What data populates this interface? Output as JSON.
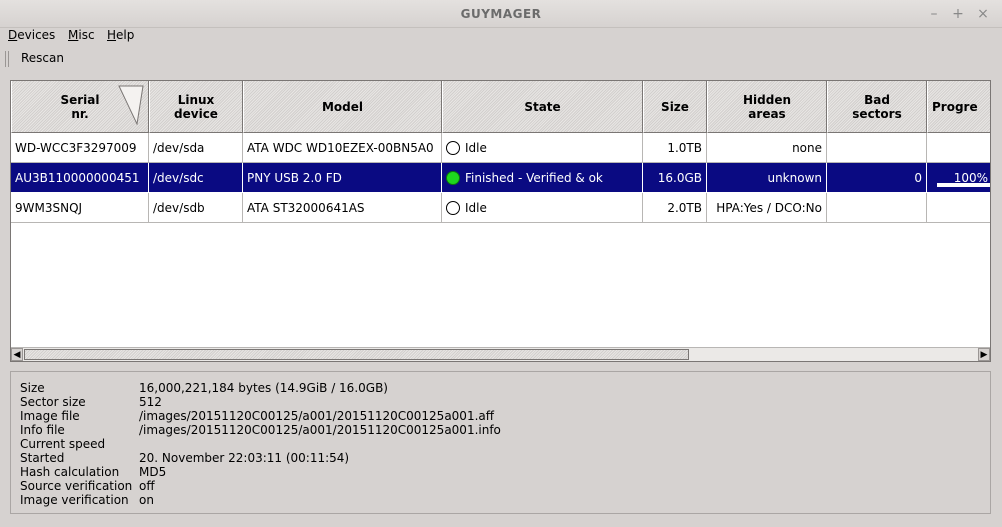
{
  "window": {
    "title": "GUYMAGER",
    "minimize": "–",
    "maximize": "+",
    "close": "×"
  },
  "menu": {
    "items": [
      {
        "label": "Devices",
        "mnemonic": "D",
        "rest": "evices"
      },
      {
        "label": "Misc",
        "mnemonic": "M",
        "rest": "isc"
      },
      {
        "label": "Help",
        "mnemonic": "H",
        "rest": "elp"
      }
    ]
  },
  "toolbar": {
    "rescan_label": "Rescan"
  },
  "table": {
    "headers": [
      "Serial\nnr.",
      "Linux\ndevice",
      "Model",
      "State",
      "Size",
      "Hidden\nareas",
      "Bad\nsectors",
      "Progre"
    ],
    "rows": [
      {
        "serial": "WD-WCC3F3297009",
        "device": "/dev/sda",
        "model": "ATA WDC WD10EZEX-00BN5A0",
        "state": "Idle",
        "state_color": "#ffffff",
        "size": "1.0TB",
        "hidden": "none",
        "bad": "",
        "progress": ""
      },
      {
        "serial": "AU3B110000000451",
        "device": "/dev/sdc",
        "model": "PNY USB 2.0 FD",
        "state": "Finished - Verified & ok",
        "state_color": "#1ed81e",
        "size": "16.0GB",
        "hidden": "unknown",
        "bad": "0",
        "progress": "100%"
      },
      {
        "serial": "9WM3SNQJ",
        "device": "/dev/sdb",
        "model": "ATA ST32000641AS",
        "state": "Idle",
        "state_color": "#ffffff",
        "size": "2.0TB",
        "hidden": "HPA:Yes / DCO:No",
        "bad": "",
        "progress": ""
      }
    ],
    "selected_row": 1
  },
  "info": {
    "rows": [
      {
        "key": "Size",
        "value": "16,000,221,184 bytes (14.9GiB / 16.0GB)"
      },
      {
        "key": "Sector size",
        "value": "512"
      },
      {
        "key": "Image file",
        "value": "/images/20151120C00125/a001/20151120C00125a001.aff"
      },
      {
        "key": "Info file",
        "value": "/images/20151120C00125/a001/20151120C00125a001.info"
      },
      {
        "key": "Current speed",
        "value": ""
      },
      {
        "key": "Started",
        "value": "20. November 22:03:11 (00:11:54)"
      },
      {
        "key": "Hash calculation",
        "value": "MD5"
      },
      {
        "key": "Source verification",
        "value": "off"
      },
      {
        "key": "Image verification",
        "value": "on"
      }
    ]
  }
}
